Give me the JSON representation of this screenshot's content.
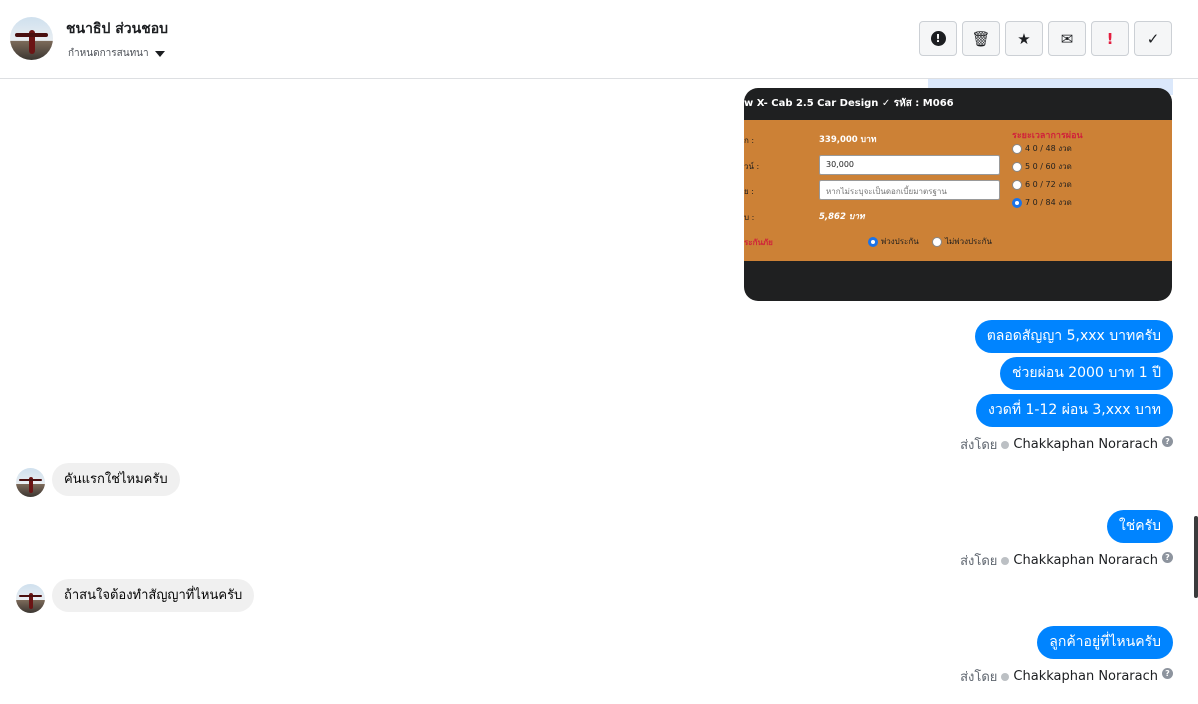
{
  "header": {
    "name": "ชนาธิป ส่วนชอบ",
    "subtitle": "กำหนดการสนทนา",
    "actions": [
      {
        "name": "report-icon",
        "glyph": "!"
      },
      {
        "name": "trash-icon",
        "glyph": "🗑"
      },
      {
        "name": "star-icon",
        "glyph": "★"
      },
      {
        "name": "mark-unread-icon",
        "glyph": "✉"
      },
      {
        "name": "important-icon",
        "glyph": "!"
      },
      {
        "name": "checkmark-icon",
        "glyph": "✓"
      }
    ]
  },
  "shared_image": {
    "title": "w X- Cab 2.5 Car Design ✓ รหัส : M066",
    "labels": [
      "ก :",
      "วน์ :",
      "ย :",
      "บ :",
      "ระกันภัย"
    ],
    "price": "339,000 บาท",
    "down_payment": "30,000",
    "interest_placeholder": "หากไม่ระบุจะเป็นดอกเบี้ยมาตรฐาน",
    "installment": "5,862 บาท",
    "period_heading": "ระยะเวลาการผ่อน",
    "periods": [
      "4 0 / 48 งวด",
      "5 0 / 60 งวด",
      "6 0 / 72 งวด",
      "7 0 / 84 งวด"
    ],
    "selected_period": 3,
    "insurance_options": [
      "พ่วงประกัน",
      "ไม่พ่วงประกัน"
    ]
  },
  "messages": {
    "out1": "ตลอดสัญญา 5,xxx บาทครับ",
    "out2": "ช่วยผ่อน 2000 บาท 1 ปี",
    "out3": "งวดที่ 1-12 ผ่อน 3,xxx บาท",
    "in1": "คันแรกใช่ไหมครับ",
    "out4": "ใช่ครับ",
    "in2": "ถ้าสนใจต้องทำสัญญาที่ไหนครับ",
    "out5": "ลูกค้าอยู่ที่ไหนครับ"
  },
  "sent_by": {
    "prefix": "ส่งโดย",
    "agent": "Chakkaphan Norarach",
    "help": "?"
  }
}
